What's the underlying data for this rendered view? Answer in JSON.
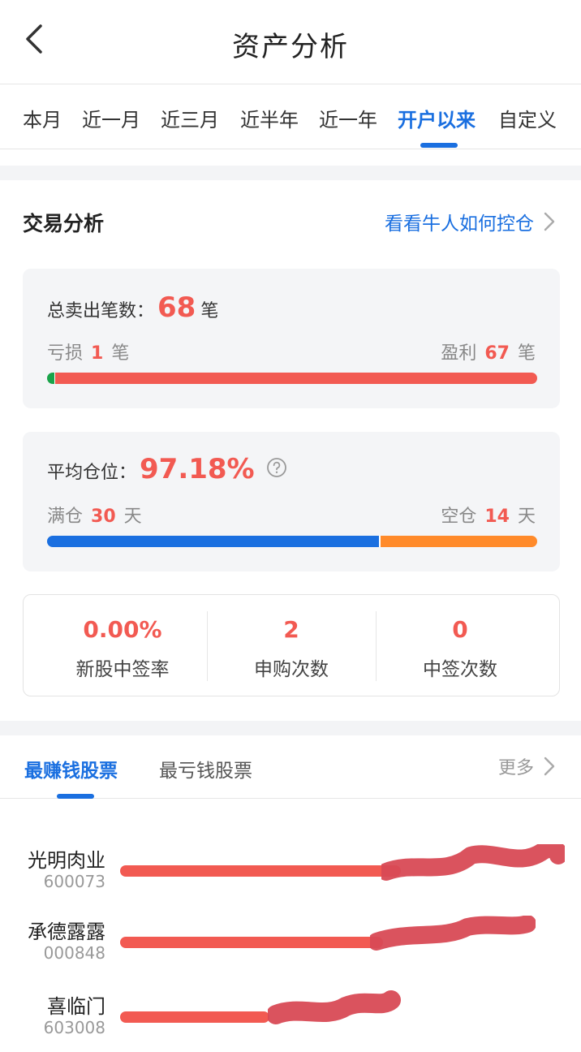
{
  "header": {
    "title": "资产分析"
  },
  "periods": {
    "tabs": [
      "本月",
      "近一月",
      "近三月",
      "近半年",
      "近一年",
      "开户以来",
      "自定义"
    ],
    "active_index": 5
  },
  "trade_analysis": {
    "title": "交易分析",
    "link_text": "看看牛人如何控仓",
    "sell_count": {
      "label": "总卖出笔数：",
      "value": "68",
      "unit": "笔",
      "loss_label": "亏损",
      "loss_value": "1",
      "loss_unit": "笔",
      "profit_label": "盈利",
      "profit_value": "67",
      "profit_unit": "笔",
      "loss_fraction": 0.0147,
      "profit_fraction": 0.9853,
      "loss_color": "#1aa34a",
      "profit_color": "#f25a52"
    },
    "position": {
      "label": "平均仓位：",
      "value": "97.18%",
      "full_label": "满仓",
      "full_value": "30",
      "full_unit": "天",
      "empty_label": "空仓",
      "empty_value": "14",
      "empty_unit": "天",
      "full_fraction": 0.68,
      "empty_fraction": 0.32,
      "full_color": "#1a6fe0",
      "empty_color": "#ff8a2a",
      "help_icon": "question-circle-icon"
    },
    "ipo_stats": [
      {
        "value": "0.00%",
        "label": "新股中签率"
      },
      {
        "value": "2",
        "label": "申购次数"
      },
      {
        "value": "0",
        "label": "中签次数"
      }
    ]
  },
  "stock_ranking": {
    "tabs": [
      "最赚钱股票",
      "最亏钱股票"
    ],
    "active_index": 0,
    "more_label": "更多",
    "stocks": [
      {
        "name": "光明肉业",
        "code": "600073",
        "bar_fraction": 0.64
      },
      {
        "name": "承德露露",
        "code": "000848",
        "bar_fraction": 0.6
      },
      {
        "name": "喜临门",
        "code": "603008",
        "bar_fraction": 0.34
      }
    ],
    "bar_color": "#f25a52"
  }
}
